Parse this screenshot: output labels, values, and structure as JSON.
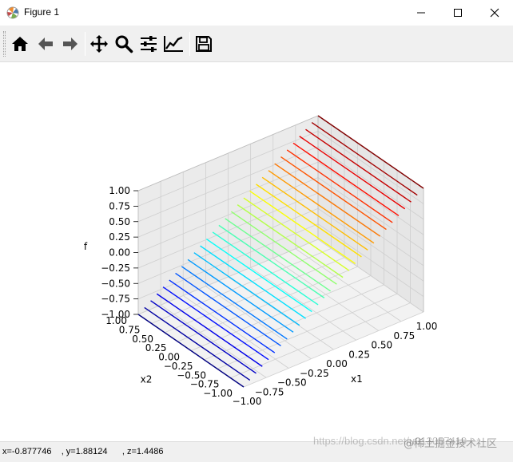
{
  "window": {
    "title": "Figure 1",
    "controls": [
      "minimize",
      "maximize",
      "close"
    ]
  },
  "toolbar": {
    "buttons": [
      {
        "name": "home",
        "icon": "home-icon"
      },
      {
        "name": "back",
        "icon": "arrow-left-icon"
      },
      {
        "name": "forward",
        "icon": "arrow-right-icon"
      },
      {
        "name": "pan",
        "icon": "move-icon"
      },
      {
        "name": "zoom",
        "icon": "magnifier-icon"
      },
      {
        "name": "subplots",
        "icon": "sliders-icon"
      },
      {
        "name": "edit-axis",
        "icon": "line-chart-icon"
      },
      {
        "name": "save",
        "icon": "floppy-disk-icon"
      }
    ]
  },
  "chart_data": {
    "type": "3d-line-surface",
    "title": "",
    "xlabel": "x1",
    "ylabel": "x2",
    "zlabel": "f",
    "xlim": [
      -1,
      1
    ],
    "ylim": [
      -1,
      1
    ],
    "zlim": [
      -1,
      1
    ],
    "x_ticks": [
      "−1.00",
      "−0.75",
      "−0.50",
      "−0.25",
      "0.00",
      "0.25",
      "0.50",
      "0.75",
      "1.00"
    ],
    "y_ticks": [
      "−1.00",
      "−0.75",
      "−0.50",
      "−0.25",
      "0.00",
      "0.25",
      "0.50",
      "0.75",
      "1.00"
    ],
    "z_ticks": [
      "−1.00",
      "−0.75",
      "−0.50",
      "−0.25",
      "0.00",
      "0.25",
      "0.50",
      "0.75",
      "1.00"
    ],
    "function": "f = x1",
    "line_count": 30,
    "colormap": "jet",
    "grid": true
  },
  "status": {
    "coords": "x=-0.877746    , y=1.88124      , z=1.4486"
  },
  "watermark": {
    "text": "https://blog.csdn.net/u013057419",
    "community": "@稀土掘金技术社区"
  }
}
